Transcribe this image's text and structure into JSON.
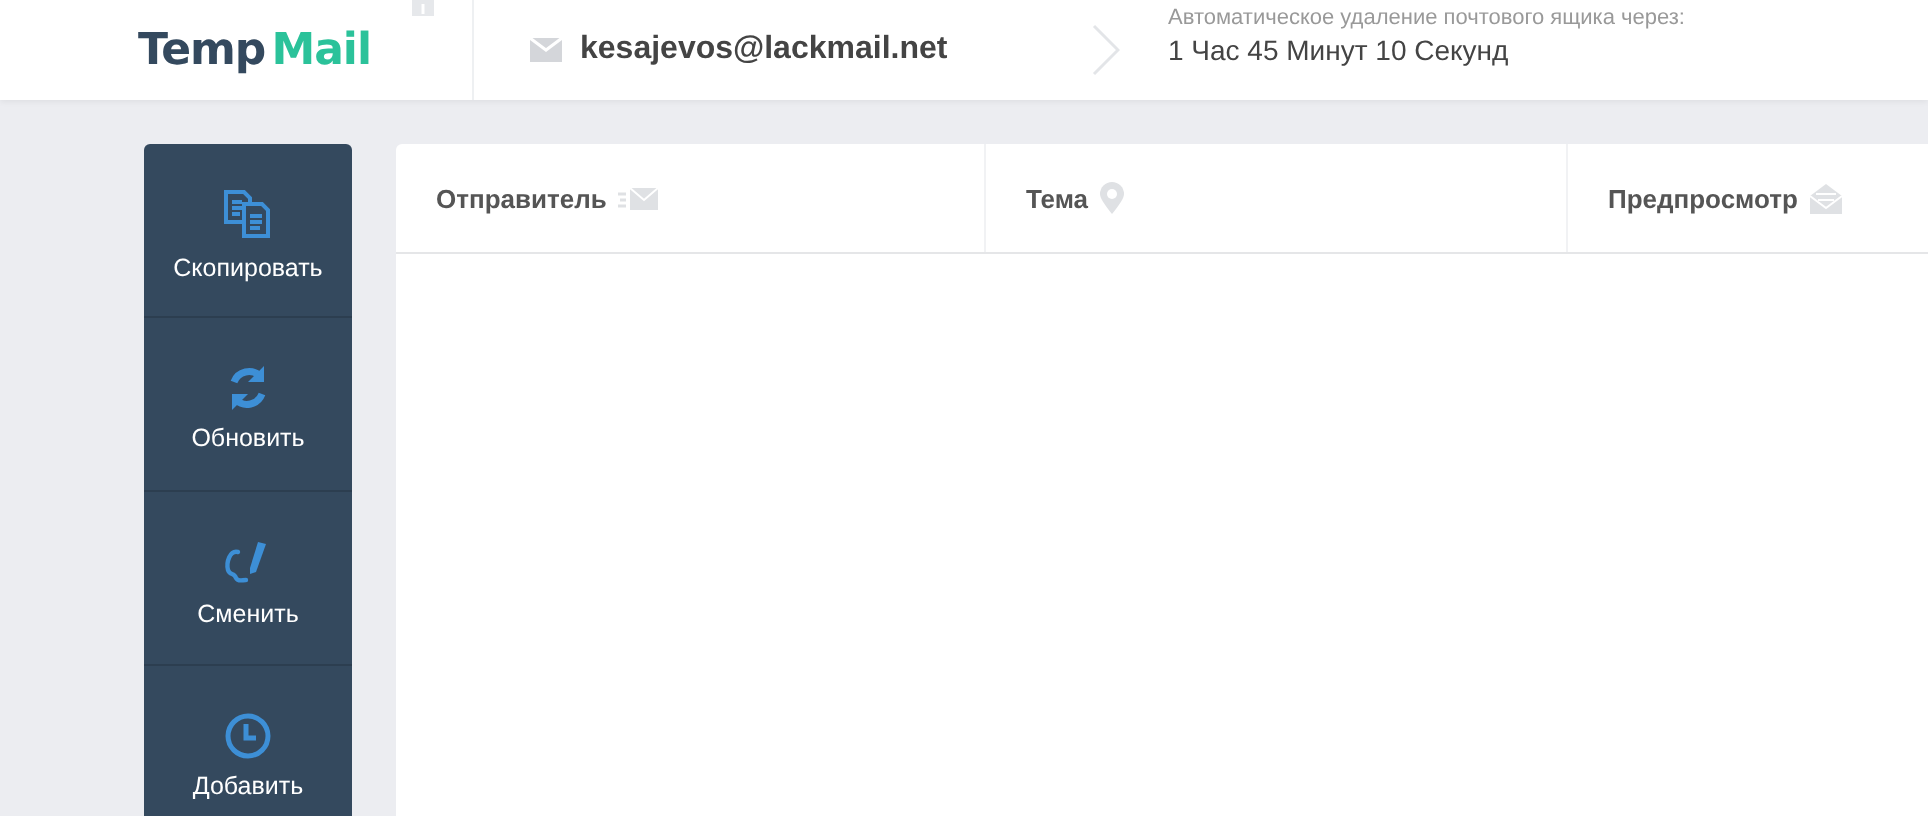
{
  "header": {
    "logo": {
      "part_1": "Temp",
      "part_2": "Mail"
    },
    "email": "kesajevos@lackmail.net",
    "timer_label": "Автоматическое удаление почтового ящика через:",
    "timer_value": "1 Час 45 Минут 10 Секунд"
  },
  "sidebar": {
    "items": [
      {
        "kind": "copy",
        "label": "Скопировать"
      },
      {
        "kind": "refresh",
        "label": "Обновить"
      },
      {
        "kind": "change",
        "label": "Сменить"
      },
      {
        "kind": "add",
        "label": "Добавить"
      }
    ]
  },
  "table": {
    "columns": [
      {
        "kind": "sender",
        "label": "Отправитель"
      },
      {
        "kind": "subject",
        "label": "Тема"
      },
      {
        "kind": "preview",
        "label": "Предпросмотр"
      }
    ]
  }
}
